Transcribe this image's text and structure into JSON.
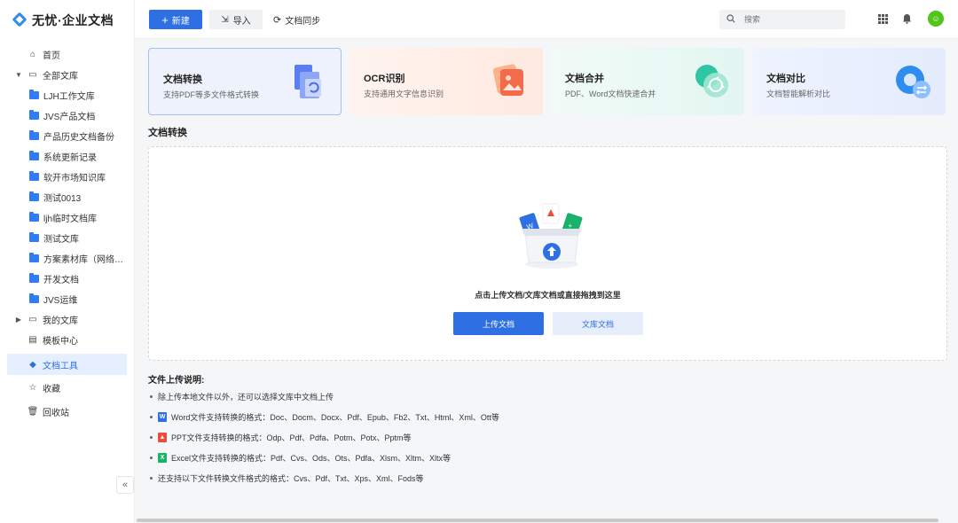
{
  "app": {
    "logo_text": "无忧·企业文档",
    "brand_color": "#2f6fe4"
  },
  "sidebar": {
    "home": "首页",
    "all_library": "全部文库",
    "folders": [
      "LJH工作文库",
      "JVS产品文档",
      "产品历史文档备份",
      "系统更新记录",
      "软开市场知识库",
      "测试0013",
      "ljh临时文档库",
      "测试文库",
      "方案素材库（网络收…",
      "开发文档",
      "JVS运维"
    ],
    "my_library": "我的文库",
    "template_center": "模板中心",
    "doc_tools": "文档工具",
    "favorites": "收藏",
    "recycle": "回收站",
    "collapse": "«"
  },
  "header": {
    "new_label": "新建",
    "import_label": "导入",
    "sync_label": "文档同步",
    "search_placeholder": "搜索"
  },
  "cards": [
    {
      "title": "文档转换",
      "desc": "支持PDF等多文件格式转换"
    },
    {
      "title": "OCR识别",
      "desc": "支持通用文字信息识别"
    },
    {
      "title": "文档合并",
      "desc": "PDF、Word文档快速合并"
    },
    {
      "title": "文档对比",
      "desc": "文档智能解析对比"
    }
  ],
  "section": {
    "title": "文档转换",
    "drop_text": "点击上传文档/文库文档或直接拖拽到这里",
    "upload_label": "上传文档",
    "library_label": "文库文档"
  },
  "notes": {
    "title": "文件上传说明:",
    "items": [
      "除上传本地文件以外，还可以选择文库中文档上传",
      "Word文件支持转换的格式：Doc、Docm、Docx、Pdf、Epub、Fb2、Txt、Html、Xml、Ott等",
      "PPT文件支持转换的格式：Odp、Pdf、Pdfa、Potm、Potx、Pptm等",
      "Excel文件支持转换的格式：Pdf、Cvs、Ods、Ots、Pdfa、Xlsm、Xltm、Xltx等",
      "还支持以下文件转换文件格式的格式：Cvs、Pdf、Txt、Xps、Xml、Fods等"
    ]
  }
}
